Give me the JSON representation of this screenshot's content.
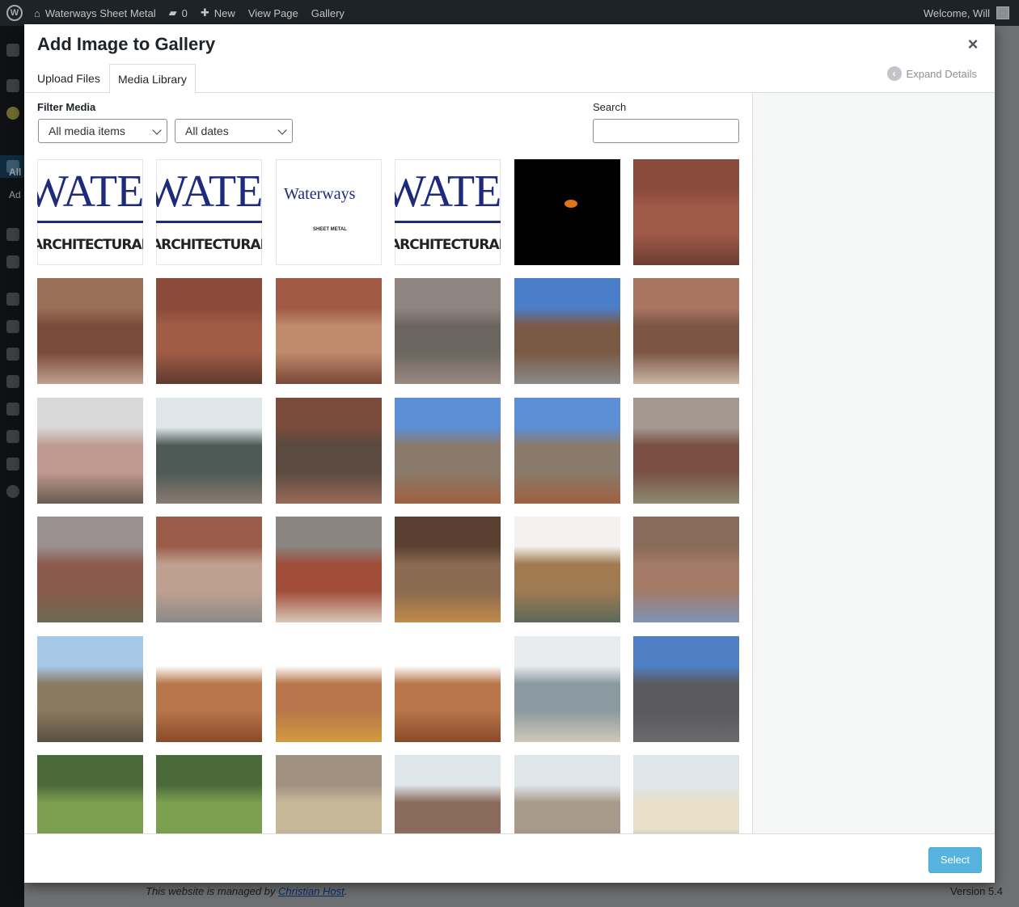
{
  "admin_bar": {
    "site_name": "Waterways Sheet Metal",
    "comments_count": "0",
    "new_label": "New",
    "view_page_label": "View Page",
    "gallery_label": "Gallery",
    "welcome": "Welcome, Will"
  },
  "sidebar": {
    "active_label": "All",
    "second_label": "Ad"
  },
  "footer": {
    "managed_prefix": "This website is managed by",
    "managed_link": "Christian Host",
    "managed_suffix": ".",
    "version": "Version 5.4"
  },
  "modal": {
    "title": "Add Image to Gallery",
    "close_symbol": "×",
    "tabs": [
      {
        "label": "Upload Files",
        "active": false
      },
      {
        "label": "Media Library",
        "active": true
      }
    ],
    "expand_details": "Expand Details",
    "filter_title": "Filter Media",
    "media_type_selected": "All media items",
    "dates_selected": "All dates",
    "search_label": "Search",
    "search_value": "",
    "select_button": "Select"
  },
  "logo_text": {
    "wide_line1": "WATERWAYS",
    "wide_line2": "ARCHITECTURAL SHEET METAL PRODUCTS",
    "small_line1": "Waterways",
    "small_line2": "SHEET METAL"
  },
  "thumbnails": [
    {
      "kind": "logo-wide"
    },
    {
      "kind": "logo-wide"
    },
    {
      "kind": "logo-small"
    },
    {
      "kind": "logo-wide"
    },
    {
      "kind": "moon"
    },
    {
      "kind": "photo",
      "colors": [
        "#8a4a3c",
        "#a05a48",
        "#6b3d31"
      ]
    },
    {
      "kind": "photo",
      "colors": [
        "#9a7058",
        "#7a4a3a",
        "#c0a090"
      ]
    },
    {
      "kind": "photo",
      "colors": [
        "#8b4a3a",
        "#a15c45",
        "#5e3a2e"
      ]
    },
    {
      "kind": "photo",
      "colors": [
        "#a05a46",
        "#c08a6c",
        "#7a4838"
      ]
    },
    {
      "kind": "photo",
      "colors": [
        "#8f8580",
        "#6b6560",
        "#9a8a80"
      ]
    },
    {
      "kind": "photo",
      "colors": [
        "#4a7ec9",
        "#7a5a44",
        "#8a8a88"
      ]
    },
    {
      "kind": "photo",
      "colors": [
        "#a87560",
        "#7d5545",
        "#c9b8a8"
      ]
    },
    {
      "kind": "photo",
      "colors": [
        "#d8d8d8",
        "#c09a90",
        "#6a5a50"
      ]
    },
    {
      "kind": "photo",
      "colors": [
        "#dfe6ea",
        "#4d5a55",
        "#8a7a70"
      ]
    },
    {
      "kind": "photo",
      "colors": [
        "#7a4a3a",
        "#5a4a40",
        "#9a6a58"
      ]
    },
    {
      "kind": "photo",
      "colors": [
        "#5d8fd6",
        "#8a7a6c",
        "#a0603e"
      ]
    },
    {
      "kind": "photo",
      "colors": [
        "#5d8fd6",
        "#8a7a6c",
        "#a0603e"
      ]
    },
    {
      "kind": "photo",
      "colors": [
        "#a59890",
        "#7a5044",
        "#8c8a70"
      ]
    },
    {
      "kind": "photo",
      "colors": [
        "#9a9090",
        "#8a5a4c",
        "#6c6a50"
      ]
    },
    {
      "kind": "photo",
      "colors": [
        "#9c5c4a",
        "#bfa090",
        "#8a8a88"
      ]
    },
    {
      "kind": "photo",
      "colors": [
        "#8a8580",
        "#a04c38",
        "#d8c8b8"
      ]
    },
    {
      "kind": "photo",
      "colors": [
        "#5a4030",
        "#8a6a50",
        "#c08a4a"
      ]
    },
    {
      "kind": "photo",
      "colors": [
        "#f4f2ee",
        "#a07a50",
        "#5a6a5a"
      ]
    },
    {
      "kind": "photo",
      "colors": [
        "#8a6a5a",
        "#a37a66",
        "#7e94b8"
      ]
    },
    {
      "kind": "photo",
      "colors": [
        "#a8c8e8",
        "#8a7a60",
        "#5a5040"
      ]
    },
    {
      "kind": "photo",
      "colors": [
        "#ffffff",
        "#b8764a",
        "#8a4a2a"
      ]
    },
    {
      "kind": "photo",
      "colors": [
        "#ffffff",
        "#b8764a",
        "#d49a40"
      ]
    },
    {
      "kind": "photo",
      "colors": [
        "#ffffff",
        "#b8764a",
        "#8a4a2a"
      ]
    },
    {
      "kind": "photo",
      "colors": [
        "#e8ecef",
        "#8a9aa0",
        "#d0c8b8"
      ]
    },
    {
      "kind": "photo",
      "colors": [
        "#4e7fc4",
        "#5a5a5c",
        "#6a6a6c"
      ]
    },
    {
      "kind": "photo",
      "colors": [
        "#4a6a3a",
        "#7aa050",
        "#8a7a68"
      ]
    },
    {
      "kind": "photo",
      "colors": [
        "#4a6a3a",
        "#7aa050",
        "#8a7a68"
      ]
    },
    {
      "kind": "photo",
      "colors": [
        "#a09080",
        "#c8b89a",
        "#8a8070"
      ]
    },
    {
      "kind": "photo",
      "colors": [
        "#dfe6ea",
        "#8a6a5a",
        "#a09080"
      ]
    },
    {
      "kind": "photo",
      "colors": [
        "#dfe6ea",
        "#a89a8a",
        "#8a7a6a"
      ]
    },
    {
      "kind": "photo",
      "colors": [
        "#dfe6ea",
        "#e8e0c8",
        "#5a7a6a"
      ]
    }
  ]
}
